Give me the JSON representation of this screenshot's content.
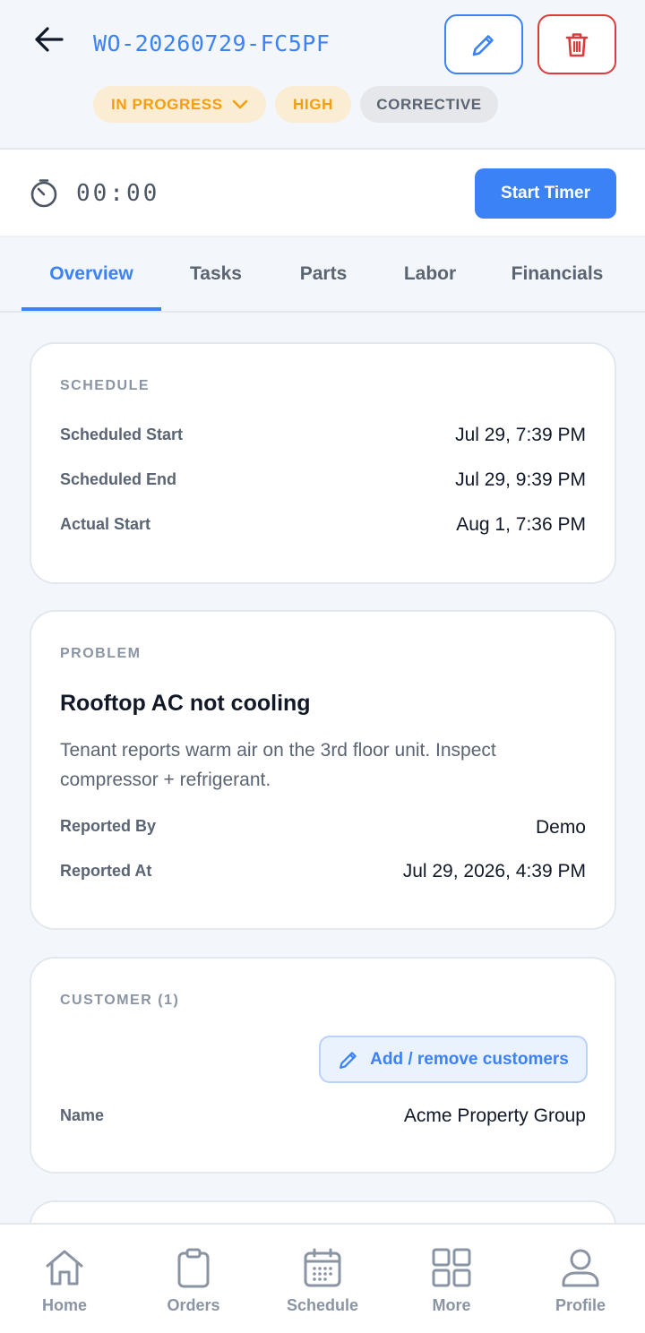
{
  "header": {
    "work_order_id": "WO-20260729-FC5PF",
    "status": "IN PROGRESS",
    "priority": "HIGH",
    "type": "CORRECTIVE"
  },
  "timer": {
    "value": "00:00",
    "start_label": "Start Timer"
  },
  "tabs": [
    {
      "label": "Overview",
      "active": true
    },
    {
      "label": "Tasks"
    },
    {
      "label": "Parts"
    },
    {
      "label": "Labor"
    },
    {
      "label": "Financials"
    }
  ],
  "schedule": {
    "title": "SCHEDULE",
    "rows": [
      {
        "label": "Scheduled Start",
        "value": "Jul 29, 7:39 PM"
      },
      {
        "label": "Scheduled End",
        "value": "Jul 29, 9:39 PM"
      },
      {
        "label": "Actual Start",
        "value": "Aug 1, 7:36 PM"
      }
    ]
  },
  "problem": {
    "title": "PROBLEM",
    "headline": "Rooftop AC not cooling",
    "description": "Tenant reports warm air on the 3rd floor unit. Inspect compressor + refrigerant.",
    "rows": [
      {
        "label": "Reported By",
        "value": "Demo"
      },
      {
        "label": "Reported At",
        "value": "Jul 29, 2026, 4:39 PM"
      }
    ]
  },
  "customer": {
    "title": "CUSTOMER (1)",
    "manage_label": "Add / remove customers",
    "name_label": "Name",
    "name_value": "Acme Property Group"
  },
  "nav": [
    {
      "label": "Home",
      "icon": "home-icon"
    },
    {
      "label": "Orders",
      "icon": "clipboard-icon"
    },
    {
      "label": "Schedule",
      "icon": "calendar-icon"
    },
    {
      "label": "More",
      "icon": "grid-icon"
    },
    {
      "label": "Profile",
      "icon": "user-icon"
    }
  ],
  "colors": {
    "accent": "#3b82f6",
    "danger": "#dc3b3b",
    "warning": "#f59e0b"
  }
}
